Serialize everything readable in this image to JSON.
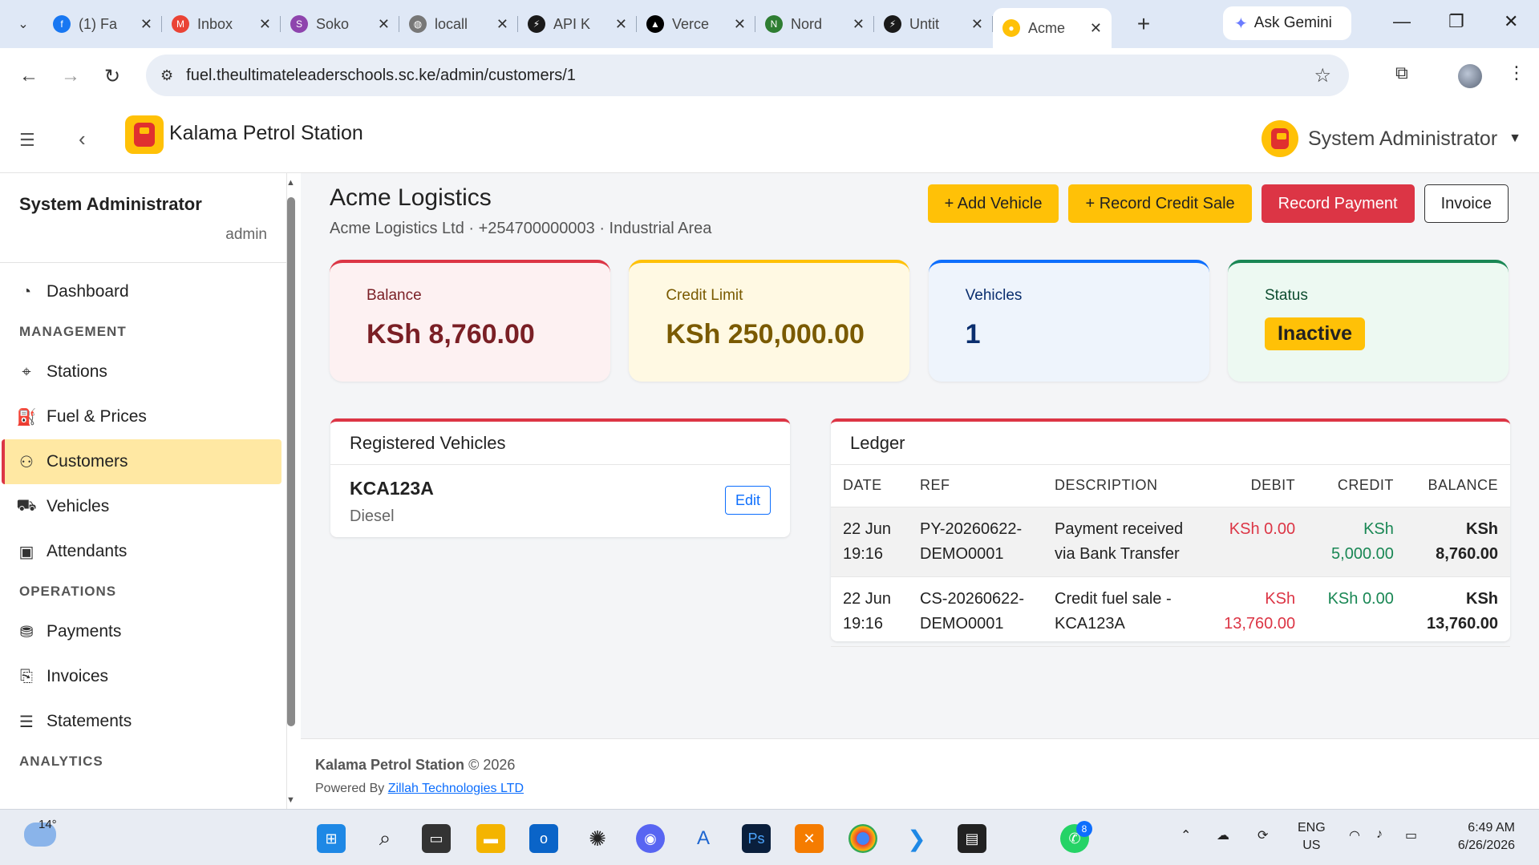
{
  "browser": {
    "tabs": [
      {
        "title": "(1) Fa",
        "color": "#1877f2",
        "glyph": "f"
      },
      {
        "title": "Inbox",
        "color": "#ea4335",
        "glyph": "M"
      },
      {
        "title": "Soko",
        "color": "#8e44ad",
        "glyph": "S"
      },
      {
        "title": "locall",
        "color": "#777777",
        "glyph": "◍"
      },
      {
        "title": "API K",
        "color": "#1a1a1a",
        "glyph": "⚡"
      },
      {
        "title": "Verce",
        "color": "#000000",
        "glyph": "▲"
      },
      {
        "title": "Nord",
        "color": "#2e7d32",
        "glyph": "N"
      },
      {
        "title": "Untit",
        "color": "#1a1a1a",
        "glyph": "⚡"
      },
      {
        "title": "Acme",
        "color": "#ffc107",
        "glyph": "●"
      }
    ],
    "ask_gemini": "Ask Gemini",
    "url": "fuel.theultimateleaderschools.sc.ke/admin/customers/1"
  },
  "header": {
    "brand": "Kalama Petrol Station",
    "user": "System Administrator"
  },
  "sidebar": {
    "user_name": "System Administrator",
    "user_role": "admin",
    "dashboard": "Dashboard",
    "section_management": "MANAGEMENT",
    "stations": "Stations",
    "fuel_prices": "Fuel & Prices",
    "customers": "Customers",
    "vehicles": "Vehicles",
    "attendants": "Attendants",
    "section_operations": "OPERATIONS",
    "payments": "Payments",
    "invoices": "Invoices",
    "statements": "Statements",
    "section_analytics": "ANALYTICS"
  },
  "customer": {
    "name": "Acme Logistics",
    "subtitle": "Acme Logistics Ltd · +254700000003 · Industrial Area"
  },
  "actions": {
    "add_vehicle": "+ Add Vehicle",
    "record_credit_sale": "+ Record Credit Sale",
    "record_payment": "Record Payment",
    "invoice": "Invoice"
  },
  "stats": {
    "balance_label": "Balance",
    "balance_value": "KSh 8,760.00",
    "credit_limit_label": "Credit Limit",
    "credit_limit_value": "KSh 250,000.00",
    "vehicles_label": "Vehicles",
    "vehicles_value": "1",
    "status_label": "Status",
    "status_value": "Inactive"
  },
  "vehicles_panel": {
    "title": "Registered Vehicles",
    "plate": "KCA123A",
    "fuel": "Diesel",
    "edit": "Edit"
  },
  "ledger": {
    "title": "Ledger",
    "headers": [
      "DATE",
      "REF",
      "DESCRIPTION",
      "DEBIT",
      "CREDIT",
      "BALANCE"
    ],
    "rows": [
      {
        "date1": "22 Jun",
        "date2": "19:16",
        "ref1": "PY-20260622-",
        "ref2": "DEMO0001",
        "desc1": "Payment received",
        "desc2": "via Bank Transfer",
        "debit1": "KSh 0.00",
        "debit2": "",
        "credit1": "KSh",
        "credit2": "5,000.00",
        "bal1": "KSh",
        "bal2": "8,760.00"
      },
      {
        "date1": "22 Jun",
        "date2": "19:16",
        "ref1": "CS-20260622-",
        "ref2": "DEMO0001",
        "desc1": "Credit fuel sale -",
        "desc2": "KCA123A",
        "debit1": "KSh",
        "debit2": "13,760.00",
        "credit1": "KSh 0.00",
        "credit2": "",
        "bal1": "KSh",
        "bal2": "13,760.00"
      }
    ]
  },
  "footer": {
    "brand": "Kalama Petrol Station",
    "copyright": "© 2026",
    "powered_by": "Powered By",
    "company": "Zillah Technologies LTD"
  },
  "taskbar": {
    "temperature": "14°",
    "lang1": "ENG",
    "lang2": "US",
    "time": "6:49 AM",
    "date": "6/26/2026",
    "whatsapp_count": "8"
  }
}
